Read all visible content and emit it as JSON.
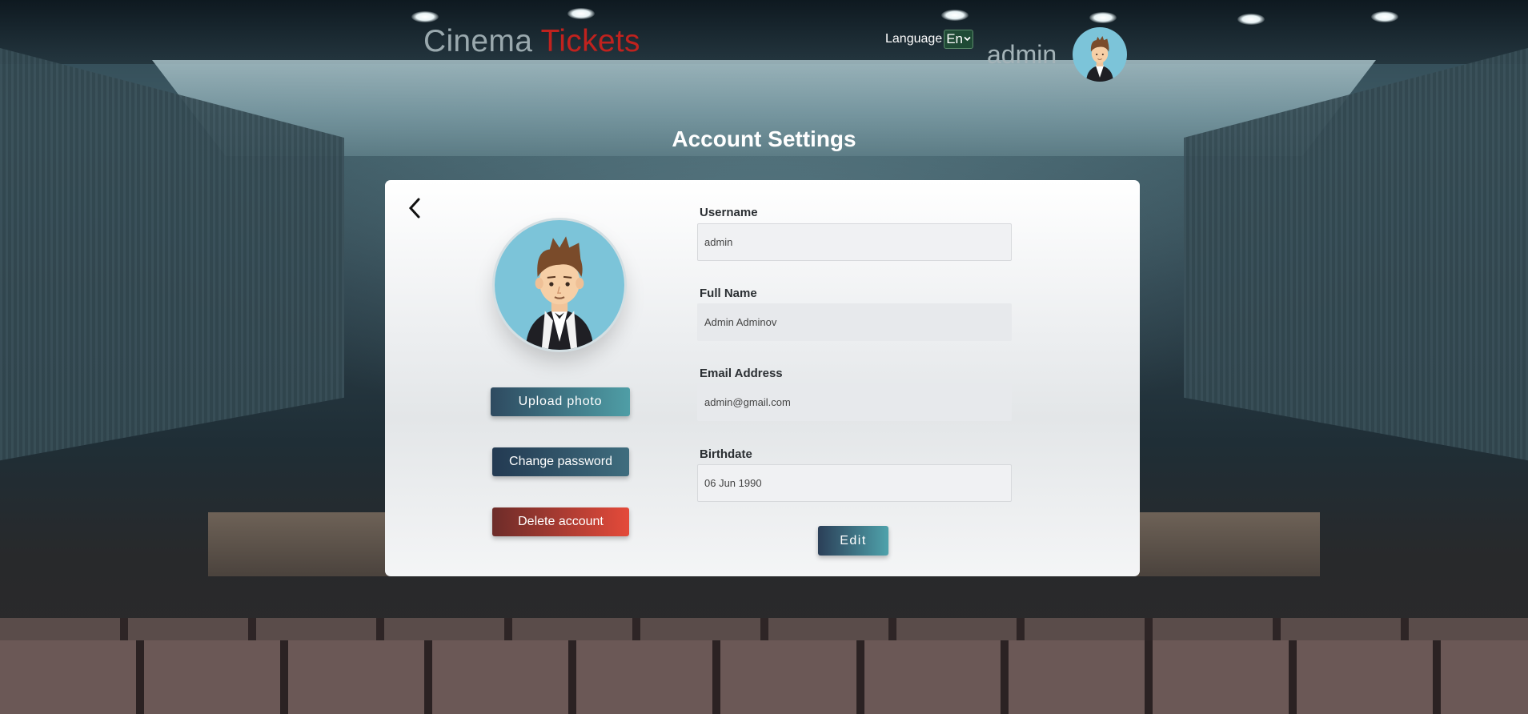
{
  "header": {
    "brand_first": "Cinema",
    "brand_second": "Tickets",
    "language_label": "Language",
    "language_value": "En",
    "user_name": "admin"
  },
  "page": {
    "title": "Account Settings"
  },
  "profile": {
    "upload_label": "Upload photo",
    "change_password_label": "Change password",
    "delete_account_label": "Delete account"
  },
  "form": {
    "username_label": "Username",
    "username_value": "admin",
    "fullname_label": "Full Name",
    "fullname_value": "Admin Adminov",
    "email_label": "Email Address",
    "email_value": "admin@gmail.com",
    "birthdate_label": "Birthdate",
    "birthdate_value": "06 Jun 1990",
    "edit_label": "Edit"
  },
  "colors": {
    "brand_accent": "#c0221e",
    "avatar_bg": "#7cc4d9",
    "delete": "#e44a3a"
  },
  "icons": {
    "back": "chevron-left-icon",
    "language_dropdown": "chevron-down-icon"
  }
}
